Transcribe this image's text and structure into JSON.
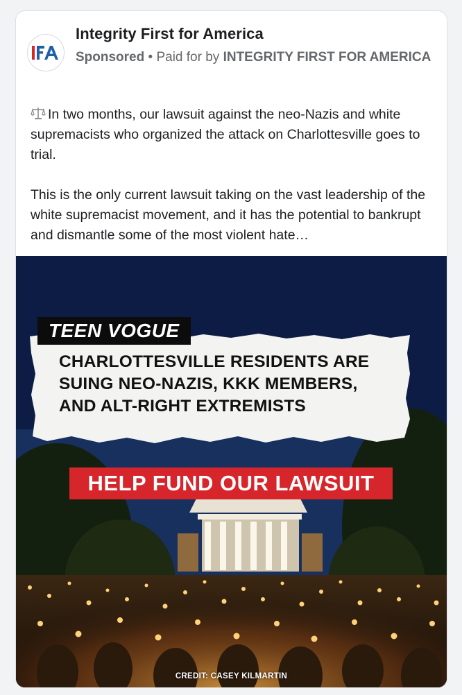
{
  "header": {
    "page_name": "Integrity First for America",
    "sponsored": "Sponsored",
    "separator": " • ",
    "paid_for_prefix": "Paid for by ",
    "paid_for_by": "INTEGRITY FIRST FOR AMERICA",
    "logo_text": "IFA"
  },
  "post": {
    "paragraph_1": "In two months, our lawsuit against the neo-Nazis and white supremacists who organized the attack on Charlottesville goes to trial.",
    "paragraph_2": "This is the only current lawsuit taking on the vast leadership of the white supremacist movement, and it has the potential to bankrupt and dismantle some of the most violent hate…",
    "leading_icon": "balance-scale-icon"
  },
  "ad_image": {
    "source_label": "TEEN VOGUE",
    "headline_line_1": "CHARLOTTESVILLE RESIDENTS ARE",
    "headline_line_2": "SUING NEO-NAZIS, KKK MEMBERS,",
    "headline_line_3": "AND ALT-RIGHT EXTREMISTS",
    "cta": "HELP FUND OUR LAWSUIT",
    "credit": "CREDIT: CASEY KILMARTIN"
  },
  "colors": {
    "logo_blue": "#1f5fa8",
    "logo_red": "#d6252b",
    "cta_red": "#d6252b",
    "muted_text": "#65676b"
  }
}
